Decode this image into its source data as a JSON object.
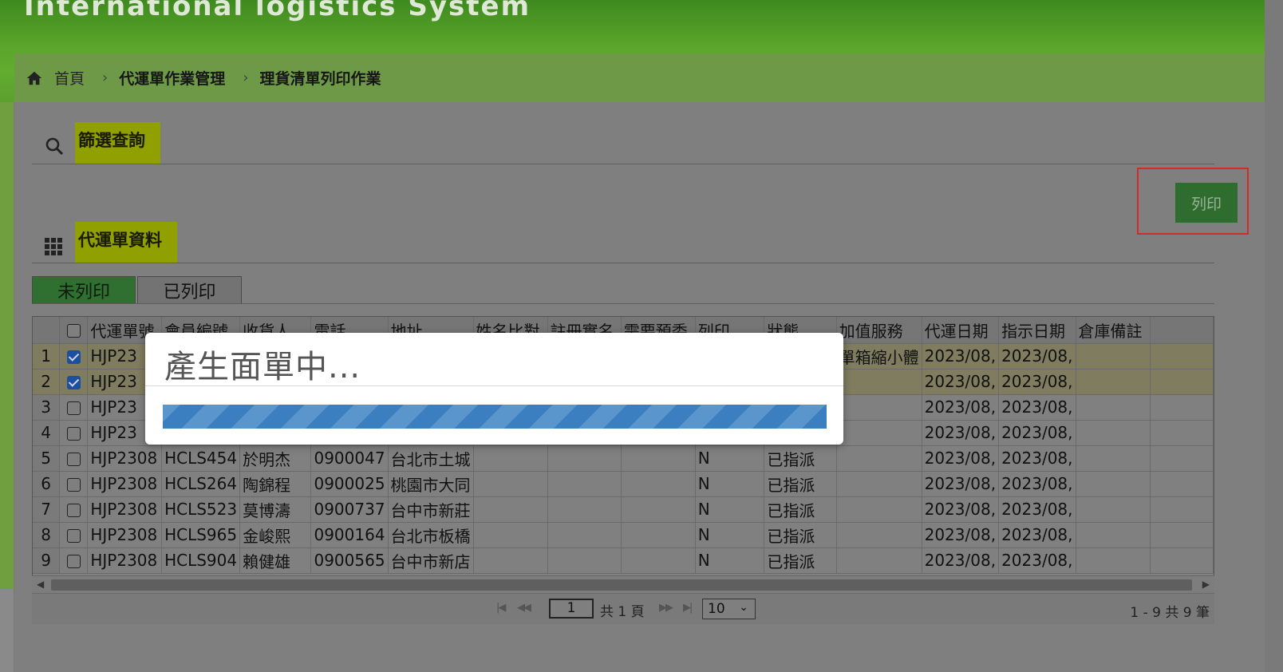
{
  "header": {
    "title": "International logistics System"
  },
  "breadcrumb": {
    "home": "首頁",
    "level1": "代運單作業管理",
    "current": "理貨清單列印作業"
  },
  "filter_section": {
    "label": "篩選查詢"
  },
  "data_section": {
    "label": "代運單資料"
  },
  "print_button": "列印",
  "tabs": {
    "unprinted": "未列印",
    "printed": "已列印"
  },
  "table": {
    "columns": [
      "代運單號",
      "會員編號",
      "收貨人",
      "電話",
      "地址",
      "姓名比對",
      "註冊實名",
      "需要預委",
      "列印",
      "狀態",
      "加值服務",
      "代運日期",
      "指示日期",
      "倉庫備註"
    ],
    "rows": [
      {
        "n": "1",
        "checked": true,
        "id": "HJP23",
        "member": "",
        "name": "",
        "phone": "",
        "addr": "",
        "c6": "",
        "c7": "",
        "c8": "",
        "print": "",
        "status": "",
        "vas": "單箱縮小體",
        "date1": "2023/08,",
        "date2": "2023/08,",
        "note": ""
      },
      {
        "n": "2",
        "checked": true,
        "id": "HJP23",
        "member": "",
        "name": "",
        "phone": "",
        "addr": "",
        "c6": "",
        "c7": "",
        "c8": "",
        "print": "",
        "status": "",
        "vas": "",
        "date1": "2023/08,",
        "date2": "2023/08,",
        "note": ""
      },
      {
        "n": "3",
        "checked": false,
        "id": "HJP23",
        "member": "",
        "name": "",
        "phone": "",
        "addr": "",
        "c6": "",
        "c7": "",
        "c8": "",
        "print": "",
        "status": "",
        "vas": "",
        "date1": "2023/08,",
        "date2": "2023/08,",
        "note": ""
      },
      {
        "n": "4",
        "checked": false,
        "id": "HJP23",
        "member": "",
        "name": "",
        "phone": "",
        "addr": "",
        "c6": "",
        "c7": "",
        "c8": "",
        "print": "",
        "status": "",
        "vas": "",
        "date1": "2023/08,",
        "date2": "2023/08,",
        "note": ""
      },
      {
        "n": "5",
        "checked": false,
        "id": "HJP2308",
        "member": "HCLS454",
        "name": "於明杰",
        "phone": "0900047",
        "addr": "台北市土城",
        "c6": "",
        "c7": "",
        "c8": "",
        "print": "N",
        "status": "已指派",
        "vas": "",
        "date1": "2023/08,",
        "date2": "2023/08,",
        "note": ""
      },
      {
        "n": "6",
        "checked": false,
        "id": "HJP2308",
        "member": "HCLS264",
        "name": "陶錦程",
        "phone": "0900025",
        "addr": "桃園市大同",
        "c6": "",
        "c7": "",
        "c8": "",
        "print": "N",
        "status": "已指派",
        "vas": "",
        "date1": "2023/08,",
        "date2": "2023/08,",
        "note": ""
      },
      {
        "n": "7",
        "checked": false,
        "id": "HJP2308",
        "member": "HCLS523",
        "name": "莫博濤",
        "phone": "0900737",
        "addr": "台中市新莊",
        "c6": "",
        "c7": "",
        "c8": "",
        "print": "N",
        "status": "已指派",
        "vas": "",
        "date1": "2023/08,",
        "date2": "2023/08,",
        "note": ""
      },
      {
        "n": "8",
        "checked": false,
        "id": "HJP2308",
        "member": "HCLS965",
        "name": "金峻熙",
        "phone": "0900164",
        "addr": "台北市板橋",
        "c6": "",
        "c7": "",
        "c8": "",
        "print": "N",
        "status": "已指派",
        "vas": "",
        "date1": "2023/08,",
        "date2": "2023/08,",
        "note": ""
      },
      {
        "n": "9",
        "checked": false,
        "id": "HJP2308",
        "member": "HCLS904",
        "name": "賴健雄",
        "phone": "0900565",
        "addr": "台中市新店",
        "c6": "",
        "c7": "",
        "c8": "",
        "print": "N",
        "status": "已指派",
        "vas": "",
        "date1": "2023/08,",
        "date2": "2023/08,",
        "note": ""
      }
    ]
  },
  "pager": {
    "page": "1",
    "total_pages_text": "共 1 頁",
    "page_size": "10",
    "record_info": "1 - 9 共 9 筆"
  },
  "modal": {
    "title": "產生面單中..."
  },
  "colors": {
    "brand_green": "#5aa52a",
    "button_green": "#2f6d2f",
    "highlight_yellow": "#8fa000",
    "progress_blue": "#3b7fc0",
    "focus_red": "#d12b2b"
  }
}
